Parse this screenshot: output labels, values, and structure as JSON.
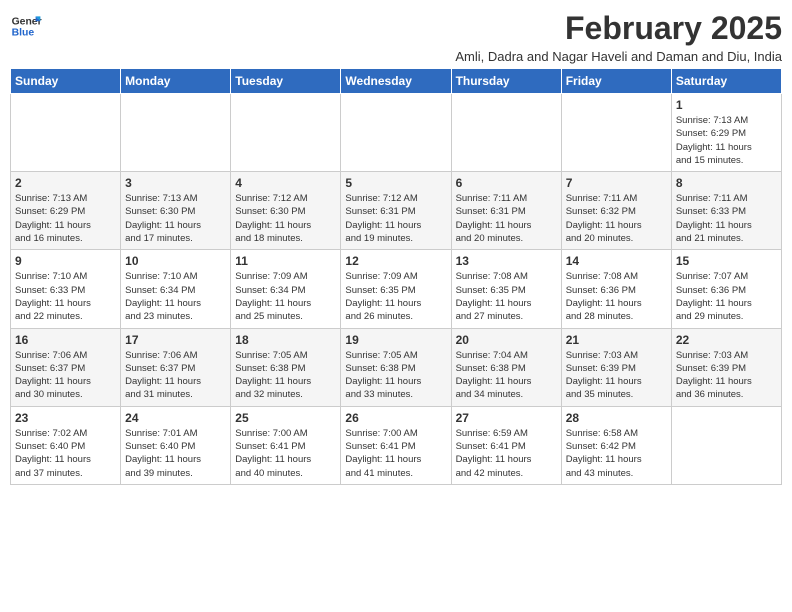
{
  "logo": {
    "line1": "General",
    "line2": "Blue"
  },
  "title": "February 2025",
  "subtitle": "Amli, Dadra and Nagar Haveli and Daman and Diu, India",
  "days_of_week": [
    "Sunday",
    "Monday",
    "Tuesday",
    "Wednesday",
    "Thursday",
    "Friday",
    "Saturday"
  ],
  "weeks": [
    [
      {
        "day": "",
        "info": ""
      },
      {
        "day": "",
        "info": ""
      },
      {
        "day": "",
        "info": ""
      },
      {
        "day": "",
        "info": ""
      },
      {
        "day": "",
        "info": ""
      },
      {
        "day": "",
        "info": ""
      },
      {
        "day": "1",
        "info": "Sunrise: 7:13 AM\nSunset: 6:29 PM\nDaylight: 11 hours\nand 15 minutes."
      }
    ],
    [
      {
        "day": "2",
        "info": "Sunrise: 7:13 AM\nSunset: 6:29 PM\nDaylight: 11 hours\nand 16 minutes."
      },
      {
        "day": "3",
        "info": "Sunrise: 7:13 AM\nSunset: 6:30 PM\nDaylight: 11 hours\nand 17 minutes."
      },
      {
        "day": "4",
        "info": "Sunrise: 7:12 AM\nSunset: 6:30 PM\nDaylight: 11 hours\nand 18 minutes."
      },
      {
        "day": "5",
        "info": "Sunrise: 7:12 AM\nSunset: 6:31 PM\nDaylight: 11 hours\nand 19 minutes."
      },
      {
        "day": "6",
        "info": "Sunrise: 7:11 AM\nSunset: 6:31 PM\nDaylight: 11 hours\nand 20 minutes."
      },
      {
        "day": "7",
        "info": "Sunrise: 7:11 AM\nSunset: 6:32 PM\nDaylight: 11 hours\nand 20 minutes."
      },
      {
        "day": "8",
        "info": "Sunrise: 7:11 AM\nSunset: 6:33 PM\nDaylight: 11 hours\nand 21 minutes."
      }
    ],
    [
      {
        "day": "9",
        "info": "Sunrise: 7:10 AM\nSunset: 6:33 PM\nDaylight: 11 hours\nand 22 minutes."
      },
      {
        "day": "10",
        "info": "Sunrise: 7:10 AM\nSunset: 6:34 PM\nDaylight: 11 hours\nand 23 minutes."
      },
      {
        "day": "11",
        "info": "Sunrise: 7:09 AM\nSunset: 6:34 PM\nDaylight: 11 hours\nand 25 minutes."
      },
      {
        "day": "12",
        "info": "Sunrise: 7:09 AM\nSunset: 6:35 PM\nDaylight: 11 hours\nand 26 minutes."
      },
      {
        "day": "13",
        "info": "Sunrise: 7:08 AM\nSunset: 6:35 PM\nDaylight: 11 hours\nand 27 minutes."
      },
      {
        "day": "14",
        "info": "Sunrise: 7:08 AM\nSunset: 6:36 PM\nDaylight: 11 hours\nand 28 minutes."
      },
      {
        "day": "15",
        "info": "Sunrise: 7:07 AM\nSunset: 6:36 PM\nDaylight: 11 hours\nand 29 minutes."
      }
    ],
    [
      {
        "day": "16",
        "info": "Sunrise: 7:06 AM\nSunset: 6:37 PM\nDaylight: 11 hours\nand 30 minutes."
      },
      {
        "day": "17",
        "info": "Sunrise: 7:06 AM\nSunset: 6:37 PM\nDaylight: 11 hours\nand 31 minutes."
      },
      {
        "day": "18",
        "info": "Sunrise: 7:05 AM\nSunset: 6:38 PM\nDaylight: 11 hours\nand 32 minutes."
      },
      {
        "day": "19",
        "info": "Sunrise: 7:05 AM\nSunset: 6:38 PM\nDaylight: 11 hours\nand 33 minutes."
      },
      {
        "day": "20",
        "info": "Sunrise: 7:04 AM\nSunset: 6:38 PM\nDaylight: 11 hours\nand 34 minutes."
      },
      {
        "day": "21",
        "info": "Sunrise: 7:03 AM\nSunset: 6:39 PM\nDaylight: 11 hours\nand 35 minutes."
      },
      {
        "day": "22",
        "info": "Sunrise: 7:03 AM\nSunset: 6:39 PM\nDaylight: 11 hours\nand 36 minutes."
      }
    ],
    [
      {
        "day": "23",
        "info": "Sunrise: 7:02 AM\nSunset: 6:40 PM\nDaylight: 11 hours\nand 37 minutes."
      },
      {
        "day": "24",
        "info": "Sunrise: 7:01 AM\nSunset: 6:40 PM\nDaylight: 11 hours\nand 39 minutes."
      },
      {
        "day": "25",
        "info": "Sunrise: 7:00 AM\nSunset: 6:41 PM\nDaylight: 11 hours\nand 40 minutes."
      },
      {
        "day": "26",
        "info": "Sunrise: 7:00 AM\nSunset: 6:41 PM\nDaylight: 11 hours\nand 41 minutes."
      },
      {
        "day": "27",
        "info": "Sunrise: 6:59 AM\nSunset: 6:41 PM\nDaylight: 11 hours\nand 42 minutes."
      },
      {
        "day": "28",
        "info": "Sunrise: 6:58 AM\nSunset: 6:42 PM\nDaylight: 11 hours\nand 43 minutes."
      },
      {
        "day": "",
        "info": ""
      }
    ]
  ]
}
